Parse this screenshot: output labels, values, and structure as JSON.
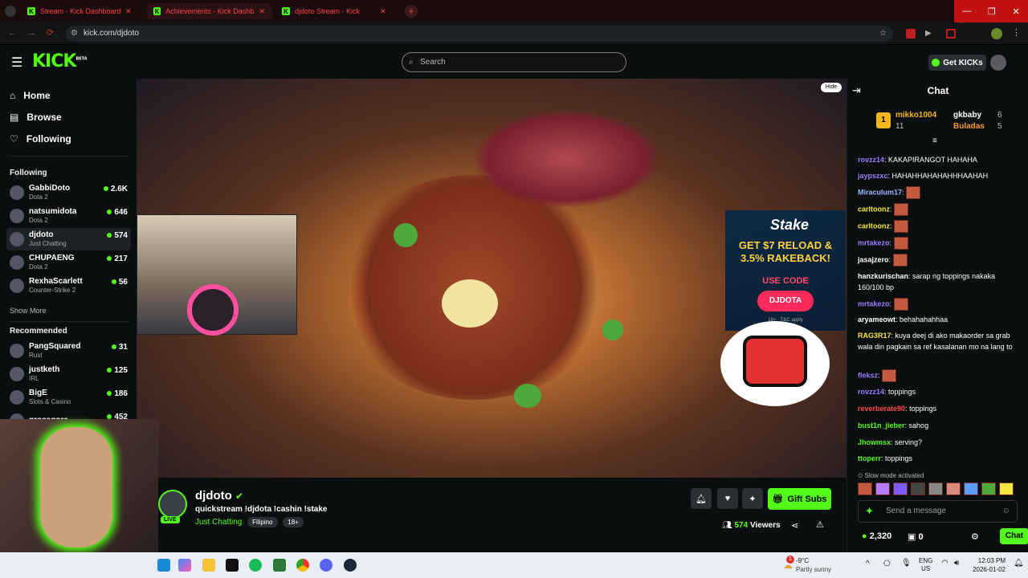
{
  "browser": {
    "tabs": [
      {
        "label": "Stream - Kick Dashboard"
      },
      {
        "label": "Achievements - Kick Dashboard"
      },
      {
        "label": "djdoto Stream - Kick"
      }
    ],
    "url": "kick.com/djdoto"
  },
  "header": {
    "logo": "KICK",
    "logo_beta": "BETA",
    "search_placeholder": "Search",
    "get_kicks_label": "Get KICKs"
  },
  "sidebar": {
    "nav": [
      {
        "label": "Home",
        "icon": "home-icon"
      },
      {
        "label": "Browse",
        "icon": "browse-icon"
      },
      {
        "label": "Following",
        "icon": "heart-icon"
      }
    ],
    "following_title": "Following",
    "following": [
      {
        "name": "GabbiDoto",
        "category": "Dota 2",
        "viewers": "2.6K"
      },
      {
        "name": "natsumidota",
        "category": "Dota 2",
        "viewers": "646"
      },
      {
        "name": "djdoto",
        "category": "Just Chatting",
        "viewers": "574"
      },
      {
        "name": "CHUPAENG",
        "category": "Dota 2",
        "viewers": "217"
      },
      {
        "name": "RexhaScarlett",
        "category": "Counter-Strike 2",
        "viewers": "56"
      }
    ],
    "show_more": "Show More",
    "recommended_title": "Recommended",
    "recommended": [
      {
        "name": "PangSquared",
        "category": "Rust",
        "viewers": "31"
      },
      {
        "name": "justketh",
        "category": "IRL",
        "viewers": "125"
      },
      {
        "name": "BigE",
        "category": "Slots & Casino",
        "viewers": "186"
      },
      {
        "name": "grossgore",
        "category": "",
        "viewers": "452"
      }
    ]
  },
  "video": {
    "hide_label": "Hide",
    "ad": {
      "brand": "Stake",
      "headline": "GET $7 RELOAD & 3.5% RAKEBACK!",
      "use_code": "USE CODE",
      "code": "DJDOTA",
      "fine_print": "18+ · T&C apply"
    }
  },
  "stream": {
    "name": "djdoto",
    "title": "quickstream !djdota !cashin !stake",
    "live_label": "LIVE",
    "category": "Just Chatting",
    "tags": [
      "Filipino",
      "18+"
    ],
    "gift_label": "Gift Subs",
    "viewers": "574",
    "viewers_label": "Viewers"
  },
  "chat": {
    "title": "Chat",
    "leaderboard": [
      {
        "rank": "1",
        "name": "mikko1004",
        "count": "11"
      },
      {
        "name": "gkbaby",
        "count": "6"
      },
      {
        "name": "Buladas",
        "count": "5"
      }
    ],
    "messages": [
      {
        "user": "rovzz14",
        "text": "KAKAPIRANGOT HAHAHA",
        "color": "#9b7dff"
      },
      {
        "user": "jaypszxc",
        "text": "HAHAHHAHAHAHHHAAHAH",
        "color": "#9b7dff"
      },
      {
        "user": "Miraculum17",
        "text": "",
        "color": "#9bb8ff"
      },
      {
        "user": "carltoonz",
        "text": "",
        "color": "#f5e642"
      },
      {
        "user": "carltoonz",
        "text": "",
        "color": "#f5e642"
      },
      {
        "user": "mrtakezo",
        "text": "",
        "color": "#9b7dff"
      },
      {
        "user": "jasajzero",
        "text": "",
        "color": "#fff"
      },
      {
        "user": "hanzkurischan",
        "text": "sarap ng toppings nakaka 160/100 bp",
        "color": "#fff"
      },
      {
        "user": "mrtakezo",
        "text": "",
        "color": "#9b7dff"
      },
      {
        "user": "aryameowt",
        "text": "behahahahhaa",
        "color": "#fff"
      },
      {
        "user": "RAG3R17",
        "text": "kuya deej di ako makaorder sa grab wala din pagkain sa ref kasalanan mo na lang to",
        "color": "#f5e642"
      },
      {
        "user": "fleksz",
        "text": "",
        "color": "#9b7dff"
      },
      {
        "user": "rovzz14",
        "text": "toppings",
        "color": "#9b7dff"
      },
      {
        "user": "reverberate90",
        "text": "toppings",
        "color": "#ff4a4a"
      },
      {
        "user": "bust1n_jieber",
        "text": "sahog",
        "color": "#53fc18"
      },
      {
        "user": "Jhowmsx",
        "text": "serving?",
        "color": "#53fc18"
      },
      {
        "user": "ttoperr",
        "text": "toppings",
        "color": "#53fc18"
      }
    ],
    "slow_mode": "Slow mode activated",
    "input_placeholder": "Send a message",
    "kicks_count": "2,320",
    "gift_count": "0",
    "send_label": "Chat"
  },
  "taskbar": {
    "weather_temp": "-9°C",
    "weather_desc": "Partly sunny",
    "weather_badge": "1",
    "lang": "ENG",
    "region": "US",
    "time": "12:03 PM",
    "date": "2026-01-02"
  },
  "colors": {
    "accent": "#53fc18",
    "bg": "#0b0e0f",
    "panel": "#2a2f31"
  }
}
